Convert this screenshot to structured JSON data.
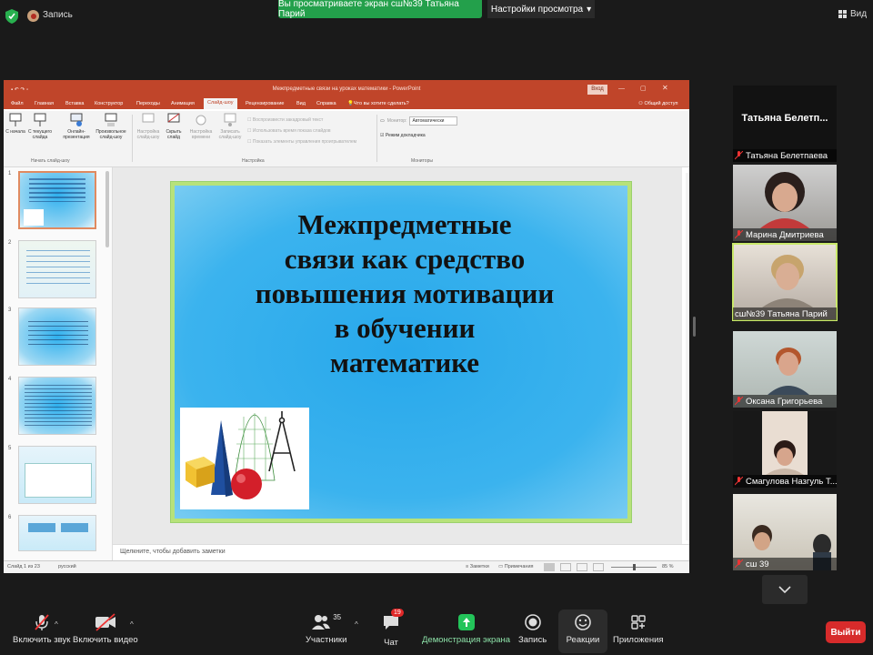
{
  "topbar": {
    "recording_label": "Запись",
    "share_banner": "Вы просматриваете экран сш№39 Татьяна Парий",
    "view_options": "Настройки просмотра",
    "view_button": "Вид"
  },
  "ppt": {
    "window_title": "Межпредметные связи на уроках математики - PowerPoint",
    "signin": "Вход",
    "menu_tabs": [
      "Файл",
      "Главная",
      "Вставка",
      "Конструктор",
      "Переходы",
      "Анимация",
      "Слайд-шоу",
      "Рецензирование",
      "Вид",
      "Справка"
    ],
    "tell_me": "Что вы хотите сделать?",
    "share": "Общий доступ",
    "ribbon": {
      "from_start": "С начала",
      "from_current": "С текущего слайда",
      "online": "Онлайн-презентация",
      "custom": "Произвольное слайд-шоу",
      "group_start": "Начать слайд-шоу",
      "setup": "Настройка слайд-шоу",
      "hide": "Скрыть слайд",
      "rehearse": "Настройка времени",
      "record": "Записать слайд-шоу",
      "play_narrations": "Воспроизвести закадровый текст",
      "use_timings": "Использовать время показа слайдов",
      "show_controls": "Показать элементы управления проигрывателем",
      "group_setup": "Настройка",
      "monitor_label": "Монитор:",
      "monitor_value": "Автоматически",
      "presenter_view": "Режим докладчика",
      "group_monitors": "Мониторы"
    },
    "slide_numbers": [
      "1",
      "2",
      "3",
      "4",
      "5",
      "6"
    ],
    "slide_title_lines": [
      "Межпредметные",
      "связи как средство",
      "повышения мотивации",
      "в обучении",
      "математике"
    ],
    "notes_placeholder": "Щелкните, чтобы добавить заметки",
    "status": {
      "slide_count": "Слайд 1 из 23",
      "language": "русский",
      "notes": "Заметки",
      "comments": "Примечания",
      "zoom": "85 %"
    }
  },
  "participants": [
    {
      "name": "Татьяна Белетп...",
      "label": "Татьяна Белетпаева",
      "muted": true,
      "video": false
    },
    {
      "name": "Марина Дмитриева",
      "muted": true,
      "video": true
    },
    {
      "name": "сш№39 Татьяна Парий",
      "muted": false,
      "video": true,
      "active": true
    },
    {
      "name": "Оксана Григорьева",
      "muted": true,
      "video": true
    },
    {
      "name": "Смагулова Назгуль Т...",
      "muted": true,
      "video": true
    },
    {
      "name": "сш 39",
      "muted": true,
      "video": true
    }
  ],
  "toolbar": {
    "unmute": "Включить звук",
    "start_video": "Включить видео",
    "participants": "Участники",
    "participants_count": "35",
    "chat": "Чат",
    "chat_badge": "19",
    "share_screen": "Демонстрация экрана",
    "record": "Запись",
    "reactions": "Реакции",
    "apps": "Приложения",
    "leave": "Выйти"
  },
  "colors": {
    "share_green": "#23a04b",
    "ppt_accent": "#c0452a",
    "leave_red": "#d72b2b",
    "active_speaker": "#c9e86a"
  }
}
